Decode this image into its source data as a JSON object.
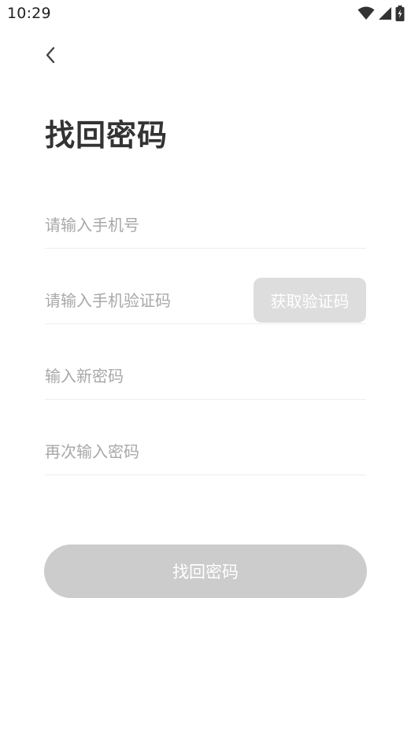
{
  "status_bar": {
    "time": "10:29",
    "icons": [
      "wifi-icon",
      "signal-icon",
      "battery-charging-icon"
    ]
  },
  "header": {
    "back_icon": "chevron-left-icon",
    "title": "找回密码"
  },
  "form": {
    "phone": {
      "value": "",
      "placeholder": "请输入手机号"
    },
    "code": {
      "value": "",
      "placeholder": "请输入手机验证码"
    },
    "get_code_label": "获取验证码",
    "new_password": {
      "value": "",
      "placeholder": "输入新密码"
    },
    "confirm_password": {
      "value": "",
      "placeholder": "再次输入密码"
    },
    "submit_label": "找回密码"
  },
  "colors": {
    "title": "#333333",
    "placeholder": "#a8a8a8",
    "divider": "#eeeeee",
    "get_code_bg": "#dddddd",
    "submit_bg": "#cccccc",
    "button_text": "#ffffff"
  }
}
